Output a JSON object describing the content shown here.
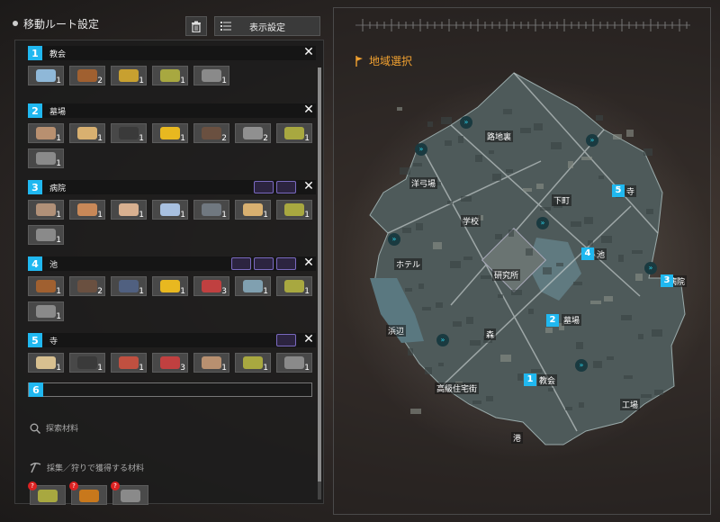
{
  "header": {
    "title": "移動ルート設定",
    "display_settings": "表示設定"
  },
  "stops": [
    {
      "num": "1",
      "name": "教会",
      "items": [
        {
          "icon": "bottle-icon",
          "count": "1",
          "color": "#8fb8d8"
        },
        {
          "icon": "arrow-icon",
          "count": "2",
          "color": "#a06030"
        },
        {
          "icon": "chalice-icon",
          "count": "1",
          "color": "#c8a030"
        },
        {
          "icon": "herb-icon",
          "count": "1",
          "color": "#a8a840"
        },
        {
          "icon": "ore-icon",
          "count": "1",
          "color": "#8a8a8a"
        }
      ],
      "tools": []
    },
    {
      "num": "2",
      "name": "墓場",
      "items": [
        {
          "icon": "leather-icon",
          "count": "1",
          "color": "#b89070"
        },
        {
          "icon": "bone-icon",
          "count": "1",
          "color": "#d8b070"
        },
        {
          "icon": "ring-icon",
          "count": "1",
          "color": "#3a3a3a"
        },
        {
          "icon": "flower-icon",
          "count": "1",
          "color": "#e8b820"
        },
        {
          "icon": "pickaxe-icon",
          "count": "2",
          "color": "#6a5040"
        },
        {
          "icon": "chain-icon",
          "count": "2",
          "color": "#909090"
        },
        {
          "icon": "herb-icon",
          "count": "1",
          "color": "#a8a840"
        },
        {
          "icon": "ore-icon",
          "count": "1",
          "color": "#8a8a8a"
        }
      ],
      "tools": []
    },
    {
      "num": "3",
      "name": "病院",
      "items": [
        {
          "icon": "leather-icon",
          "count": "1",
          "color": "#b09078"
        },
        {
          "icon": "bone-icon",
          "count": "1",
          "color": "#c88858"
        },
        {
          "icon": "cloth-icon",
          "count": "1",
          "color": "#d8b090"
        },
        {
          "icon": "syringe-icon",
          "count": "1",
          "color": "#a8c0e0"
        },
        {
          "icon": "metal-icon",
          "count": "1",
          "color": "#707880"
        },
        {
          "icon": "bone-icon",
          "count": "1",
          "color": "#d8b070"
        },
        {
          "icon": "herb-icon",
          "count": "1",
          "color": "#a8a840"
        },
        {
          "icon": "ore-icon",
          "count": "1",
          "color": "#8a8a8a"
        }
      ],
      "tools": [
        "glove-tool-icon",
        "knife-tool-icon"
      ]
    },
    {
      "num": "4",
      "name": "池",
      "items": [
        {
          "icon": "stick-icon",
          "count": "1",
          "color": "#a06030"
        },
        {
          "icon": "pickaxe-icon",
          "count": "2",
          "color": "#6a5040"
        },
        {
          "icon": "cap-icon",
          "count": "1",
          "color": "#506080"
        },
        {
          "icon": "flower-icon",
          "count": "1",
          "color": "#e8b820"
        },
        {
          "icon": "gem-icon",
          "count": "3",
          "color": "#c04040"
        },
        {
          "icon": "wire-icon",
          "count": "1",
          "color": "#80a0b0"
        },
        {
          "icon": "herb-icon",
          "count": "1",
          "color": "#a8a840"
        },
        {
          "icon": "ore-icon",
          "count": "1",
          "color": "#8a8a8a"
        }
      ],
      "tools": [
        "fire-tool-icon",
        "fish-tool-icon",
        "bullet-tool-icon"
      ]
    },
    {
      "num": "5",
      "name": "寺",
      "items": [
        {
          "icon": "book-icon",
          "count": "1",
          "color": "#d8c090"
        },
        {
          "icon": "ring-icon",
          "count": "1",
          "color": "#3a3a3a"
        },
        {
          "icon": "crystal-icon",
          "count": "1",
          "color": "#c05040"
        },
        {
          "icon": "gem-icon",
          "count": "3",
          "color": "#c04040"
        },
        {
          "icon": "leather-icon",
          "count": "1",
          "color": "#b89070"
        },
        {
          "icon": "herb-icon",
          "count": "1",
          "color": "#a8a840"
        },
        {
          "icon": "ore-icon",
          "count": "1",
          "color": "#8a8a8a"
        }
      ],
      "tools": [
        "eye-tool-icon"
      ]
    }
  ],
  "slot6": "6",
  "search_materials": "探索材料",
  "gather_materials": "採集／狩りで獲得する材料",
  "needed": [
    {
      "icon": "herb-icon",
      "color": "#a8a840"
    },
    {
      "icon": "leaf-icon",
      "color": "#c8781c"
    },
    {
      "icon": "ore-icon",
      "color": "#8a8a8a"
    }
  ],
  "map": {
    "title": "地域選択",
    "areas": [
      "路地裏",
      "洋弓場",
      "下町",
      "学校",
      "ホテル",
      "研究所",
      "池",
      "病院",
      "浜辺",
      "森",
      "墓場",
      "高級住宅街",
      "教会",
      "工場",
      "港",
      "寺"
    ],
    "badges": [
      "5",
      "4",
      "3",
      "2",
      "1"
    ]
  }
}
